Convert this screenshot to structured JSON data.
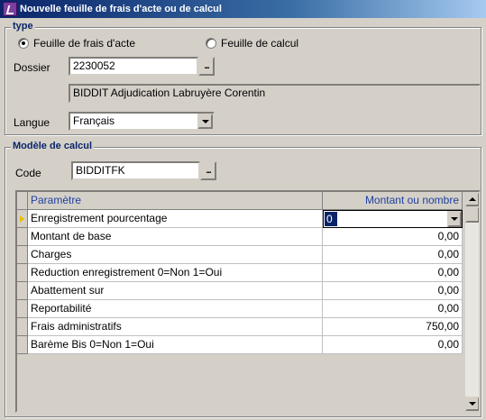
{
  "window": {
    "title": "Nouvelle feuille de frais d'acte ou de calcul"
  },
  "type_group": {
    "legend": "type",
    "option1": "Feuille de frais d'acte",
    "option2": "Feuille de calcul",
    "selected": "Feuille de frais d'acte",
    "dossier_label": "Dossier",
    "dossier_value": "2230052",
    "dossier_desc": "BIDDIT Adjudication Labruyère Corentin",
    "langue_label": "Langue",
    "langue_value": "Français"
  },
  "model_group": {
    "legend": "Modèle de calcul",
    "code_label": "Code",
    "code_value": "BIDDITFK"
  },
  "grid": {
    "col_param": "Paramètre",
    "col_amount": "Montant ou nombre",
    "rows": [
      {
        "param": "Enregistrement pourcentage",
        "amount": "0"
      },
      {
        "param": "Montant de base",
        "amount": "0,00"
      },
      {
        "param": "Charges",
        "amount": "0,00"
      },
      {
        "param": "Reduction enregistrement 0=Non 1=Oui",
        "amount": "0,00"
      },
      {
        "param": "Abattement sur",
        "amount": "0,00"
      },
      {
        "param": "Reportabilité",
        "amount": "0,00"
      },
      {
        "param": "Frais administratifs",
        "amount": "750,00"
      },
      {
        "param": "Barème Bis 0=Non 1=Oui",
        "amount": "0,00"
      }
    ]
  },
  "ellipsis": "..."
}
